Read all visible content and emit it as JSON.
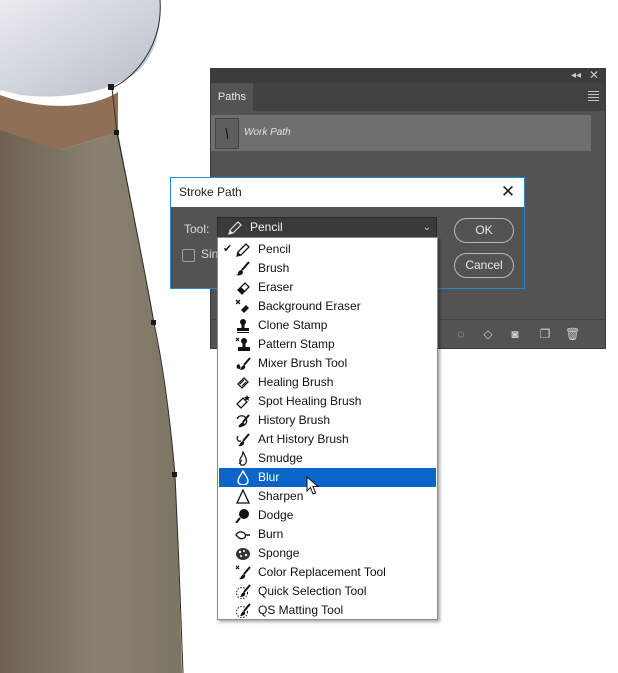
{
  "colors": {
    "accent": "#0b64c8",
    "panel_bg": "#535353",
    "dialog_border": "#2a88c8"
  },
  "paths_panel": {
    "tab_label": "Paths",
    "work_path_label": "Work Path",
    "footer_icons": [
      "selection-outline-icon",
      "selection-to-path-icon",
      "add-mask-icon",
      "new-path-icon",
      "trash-icon"
    ]
  },
  "dialog": {
    "title": "Stroke Path",
    "tool_label": "Tool:",
    "selected_tool": "Pencil",
    "simulate_label_visible": "Sin",
    "ok_label": "OK",
    "cancel_label": "Cancel"
  },
  "dropdown": {
    "checked_item": "Pencil",
    "highlighted_item": "Blur",
    "items": [
      {
        "label": "Pencil",
        "icon": "pencil-icon"
      },
      {
        "label": "Brush",
        "icon": "brush-icon"
      },
      {
        "label": "Eraser",
        "icon": "eraser-icon"
      },
      {
        "label": "Background Eraser",
        "icon": "background-eraser-icon"
      },
      {
        "label": "Clone Stamp",
        "icon": "clone-stamp-icon"
      },
      {
        "label": "Pattern Stamp",
        "icon": "pattern-stamp-icon"
      },
      {
        "label": "Mixer Brush Tool",
        "icon": "mixer-brush-icon"
      },
      {
        "label": "Healing Brush",
        "icon": "healing-brush-icon"
      },
      {
        "label": "Spot Healing Brush",
        "icon": "spot-healing-brush-icon"
      },
      {
        "label": "History Brush",
        "icon": "history-brush-icon"
      },
      {
        "label": "Art History Brush",
        "icon": "art-history-brush-icon"
      },
      {
        "label": "Smudge",
        "icon": "smudge-icon"
      },
      {
        "label": "Blur",
        "icon": "blur-icon"
      },
      {
        "label": "Sharpen",
        "icon": "sharpen-icon"
      },
      {
        "label": "Dodge",
        "icon": "dodge-icon"
      },
      {
        "label": "Burn",
        "icon": "burn-icon"
      },
      {
        "label": "Sponge",
        "icon": "sponge-icon"
      },
      {
        "label": "Color Replacement Tool",
        "icon": "color-replacement-icon"
      },
      {
        "label": "Quick Selection Tool",
        "icon": "quick-selection-icon"
      },
      {
        "label": "QS Matting Tool",
        "icon": "qs-matting-icon"
      }
    ]
  }
}
